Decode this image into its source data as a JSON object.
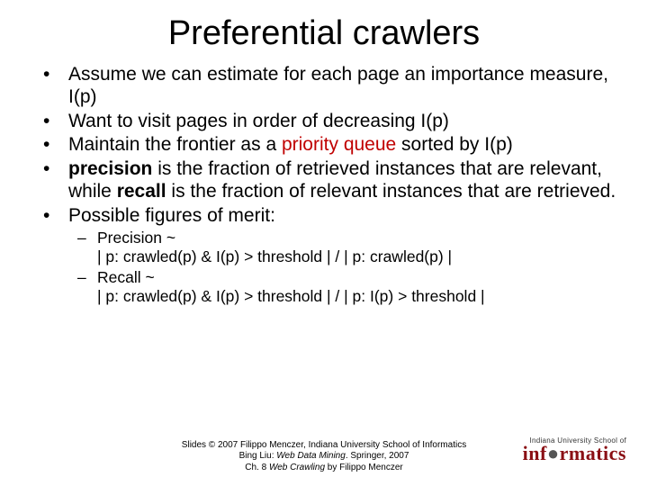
{
  "title": "Preferential crawlers",
  "bullets": {
    "b1": "Assume we can estimate for each page an importance measure, I(p)",
    "b2": "Want to visit pages in order of decreasing I(p)",
    "b3_pre": "Maintain the frontier as a ",
    "b3_em": "priority queue",
    "b3_post": " sorted by I(p)",
    "b4_w1": "precision",
    "b4_mid": " is the fraction of retrieved instances that are relevant, while ",
    "b4_w2": "recall",
    "b4_end": " is the fraction of relevant instances that are retrieved.",
    "b5": "Possible figures of merit:",
    "s1a": "Precision ~",
    "s1b": "| p: crawled(p) & I(p) > threshold | / | p: crawled(p) |",
    "s2a": "Recall ~",
    "s2b": "| p: crawled(p) & I(p) > threshold | / | p: I(p) > threshold |"
  },
  "footer": {
    "line1_pre": "Slides © 2007 Filippo Menczer, Indiana University School of Informatics",
    "line2_pre": "Bing Liu: ",
    "line2_ital": "Web Data Mining",
    "line2_post": ". Springer, 2007",
    "line3_pre": "Ch. 8 ",
    "line3_ital": "Web Crawling",
    "line3_post": " by Filippo Menczer"
  },
  "logo": {
    "top": "Indiana University School of",
    "brand_pre": "inf",
    "brand_post": "rmatics"
  }
}
